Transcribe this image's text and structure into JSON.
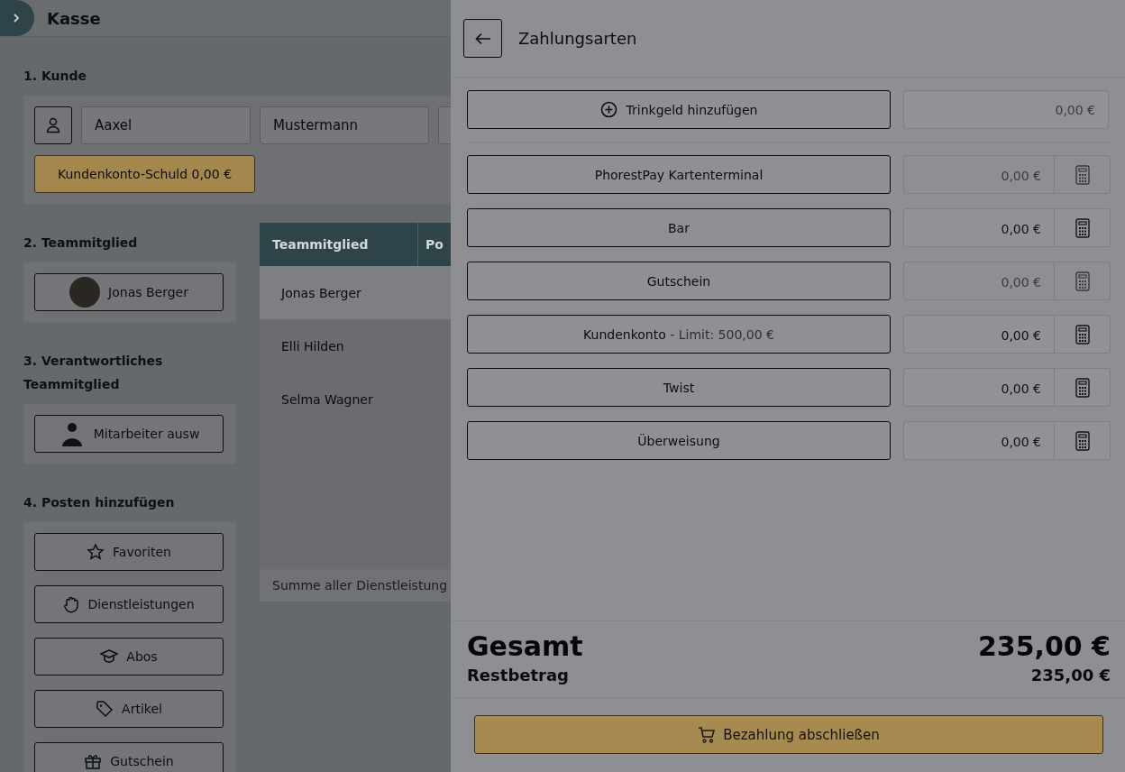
{
  "header": {
    "title": "Kasse"
  },
  "customer": {
    "heading": "1. Kunde",
    "first_name": "Aaxel",
    "last_name": "Mustermann",
    "debt_button": "Kundenkonto-Schuld 0,00 €"
  },
  "team": {
    "heading": "2. Teammitglied",
    "member": "Jonas Berger"
  },
  "responsible": {
    "heading": "3. Verantwortliches Teammitglied",
    "button": "Mitarbeiter ausw"
  },
  "add_items": {
    "heading": "4. Posten hinzufügen",
    "buttons": [
      {
        "label": "Favoriten",
        "kind": "star"
      },
      {
        "label": "Dienstleistungen",
        "kind": "hand"
      },
      {
        "label": "Abos",
        "kind": "cap"
      },
      {
        "label": "Artikel",
        "kind": "tag"
      },
      {
        "label": "Gutschein",
        "kind": "gift"
      }
    ]
  },
  "table": {
    "columns": [
      "Teammitglied",
      "Po"
    ],
    "rows": [
      {
        "name": "Jonas Berger",
        "selected": true
      },
      {
        "name": "Elli Hilden",
        "selected": false
      },
      {
        "name": "Selma Wagner",
        "selected": false
      }
    ],
    "footer": "Summe aller Dienstleistung"
  },
  "panel": {
    "title": "Zahlungsarten",
    "tip": {
      "label": "Trinkgeld hinzufügen",
      "amount": "0,00 €"
    },
    "methods": [
      {
        "label": "PhorestPay Kartenterminal",
        "amount": "0,00 €",
        "disabled": true
      },
      {
        "label": "Bar",
        "amount": "0,00 €",
        "disabled": false
      },
      {
        "label": "Gutschein",
        "amount": "0,00 €",
        "disabled": true
      },
      {
        "label": "Kundenkonto",
        "note": "- Limit: 500,00 €",
        "amount": "0,00 €",
        "disabled": false
      },
      {
        "label": "Twist",
        "amount": "0,00 €",
        "disabled": false
      },
      {
        "label": "Überweisung",
        "amount": "0,00 €",
        "disabled": false
      }
    ],
    "total_label": "Gesamt",
    "total": "235,00 €",
    "rest_label": "Restbetrag",
    "rest": "235,00 €",
    "pay_button": "Bezahlung abschließen"
  }
}
